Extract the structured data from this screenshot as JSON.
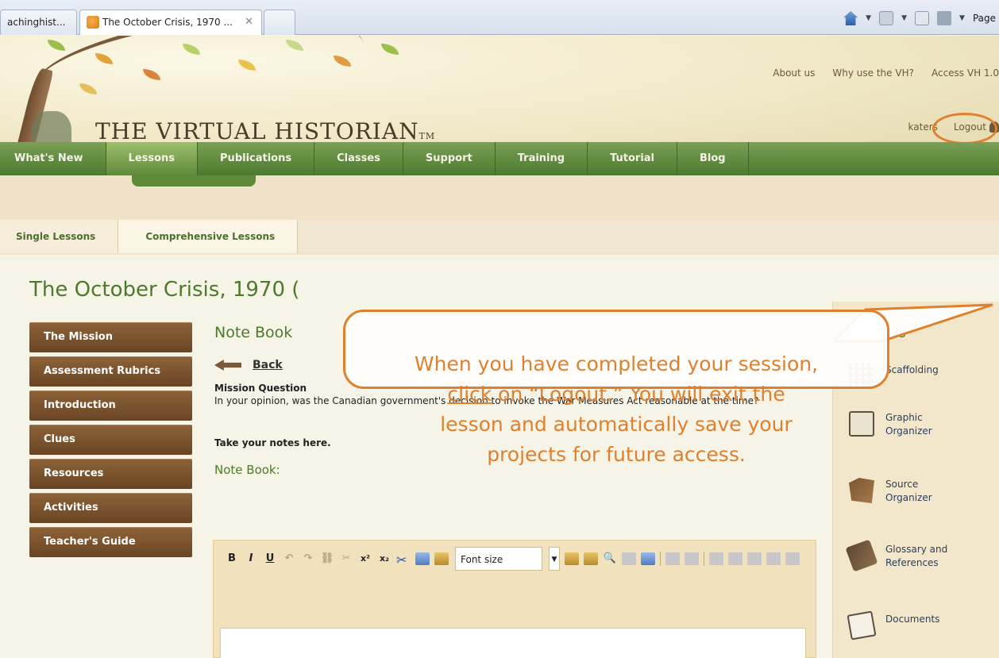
{
  "browser": {
    "tab1": "achinghist...",
    "tab2": "The October Crisis, 1970 ...",
    "tab2_close": "✕",
    "page_menu": "Page"
  },
  "header": {
    "logo": "THE VIRTUAL HISTORIAN",
    "logo_tm": "TM",
    "top_links": [
      "About us",
      "Why use the VH?",
      "Access VH 1.0"
    ],
    "username": "katers",
    "logout": "Logout"
  },
  "nav": [
    "What's New",
    "Lessons",
    "Publications",
    "Classes",
    "Support",
    "Training",
    "Tutorial",
    "Blog"
  ],
  "subnav": [
    "Single Lessons",
    "Comprehensive Lessons"
  ],
  "page_title": "The October Crisis, 1970 (",
  "left_menu": [
    "The Mission",
    "Assessment Rubrics",
    "Introduction",
    "Clues",
    "Resources",
    "Activities",
    "Teacher's Guide"
  ],
  "content": {
    "title": "Note Book",
    "back": "Back",
    "mission_label": "Mission Question",
    "mission_text": "In your opinion, was the Canadian government's decision to invoke the War Measures Act reasonable at the time?",
    "notes_prompt": "Take your notes here.",
    "notebook_label": "Note Book:"
  },
  "editor": {
    "bold": "B",
    "italic": "I",
    "underline": "U",
    "superscript": "x²",
    "subscript": "x₂",
    "font_size_placeholder": "Font size"
  },
  "tools": {
    "title": "ls",
    "items": [
      "Scaffolding",
      "Graphic Organizer",
      "Source Organizer",
      "Glossary and References",
      "Documents"
    ]
  },
  "callout": {
    "line1": "When you have completed your session,",
    "click": "click",
    "line2_rest": " on “Logout.”  You will exit the",
    "line3": "lesson and automatically save your",
    "line4": "projects for future access."
  },
  "colors": {
    "accent_orange": "#e07f2c",
    "nav_green": "#4c7a2c",
    "menu_brown": "#7a5030"
  }
}
